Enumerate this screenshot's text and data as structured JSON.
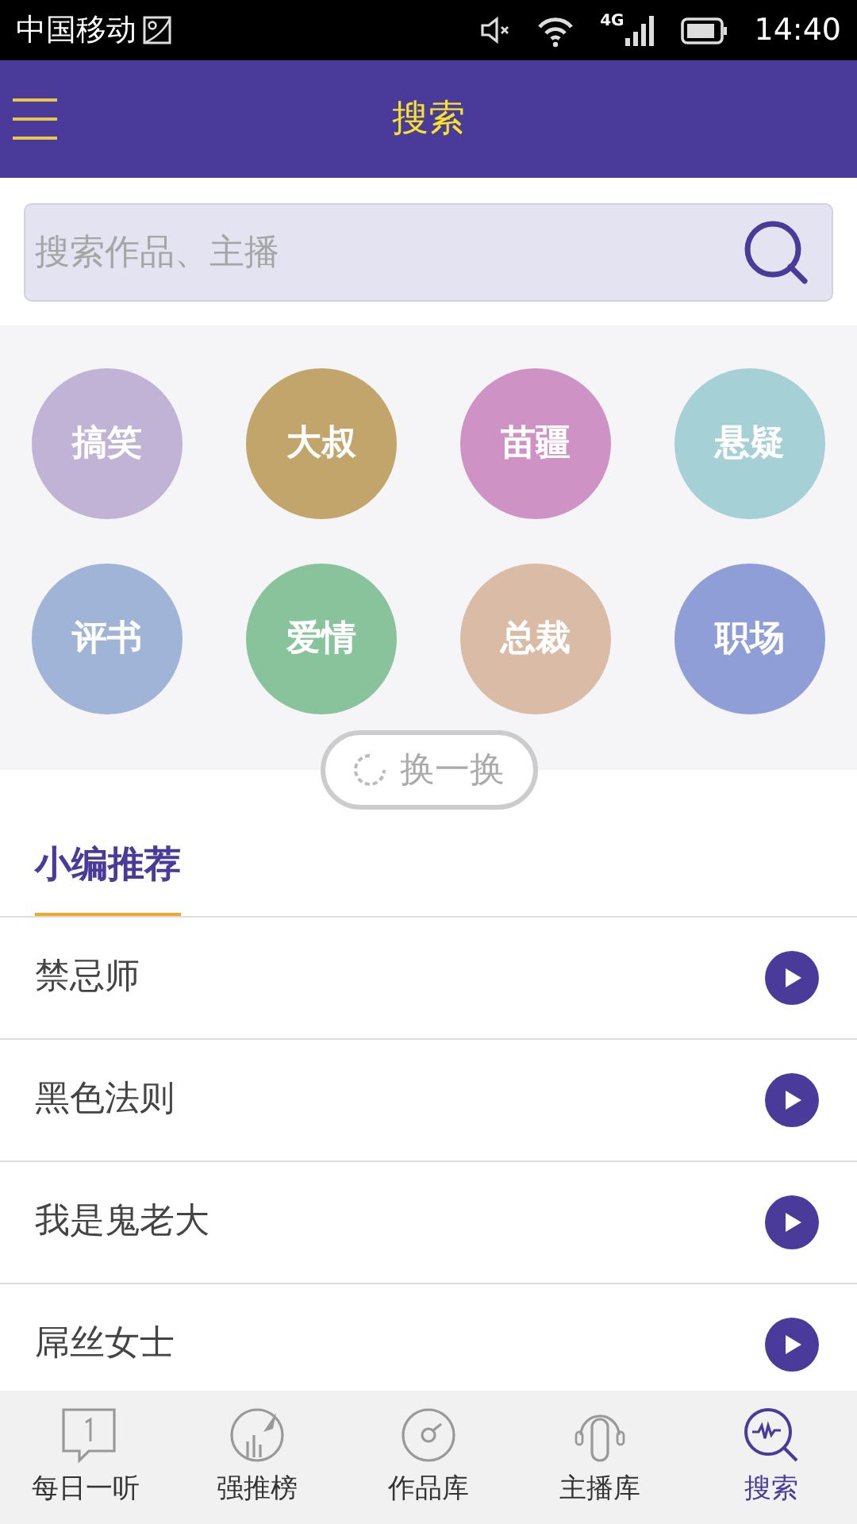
{
  "status_bar": {
    "carrier": "中国移动",
    "time": "14:40",
    "network": "4G"
  },
  "header": {
    "title": "搜索"
  },
  "search": {
    "placeholder": "搜索作品、主播"
  },
  "tags": [
    {
      "label": "搞笑",
      "color": "#c0b3d6"
    },
    {
      "label": "大叔",
      "color": "#c2a56a"
    },
    {
      "label": "苗疆",
      "color": "#cf92c4"
    },
    {
      "label": "悬疑",
      "color": "#a4d0d6"
    },
    {
      "label": "评书",
      "color": "#a0b4d8"
    },
    {
      "label": "爱情",
      "color": "#88c39b"
    },
    {
      "label": "总裁",
      "color": "#d9bba6"
    },
    {
      "label": "职场",
      "color": "#8f9ed6"
    }
  ],
  "refresh_button": "换一换",
  "section_title": "小编推荐",
  "recommendations": [
    {
      "title": "禁忌师"
    },
    {
      "title": "黑色法则"
    },
    {
      "title": "我是鬼老大"
    },
    {
      "title": "屌丝女士"
    }
  ],
  "bottom_nav": [
    {
      "label": "每日一听",
      "kind": "book",
      "selected": false
    },
    {
      "label": "强推榜",
      "kind": "rocket",
      "selected": false
    },
    {
      "label": "作品库",
      "kind": "disc",
      "selected": false
    },
    {
      "label": "主播库",
      "kind": "headphones",
      "selected": false
    },
    {
      "label": "搜索",
      "kind": "search",
      "selected": true
    }
  ]
}
